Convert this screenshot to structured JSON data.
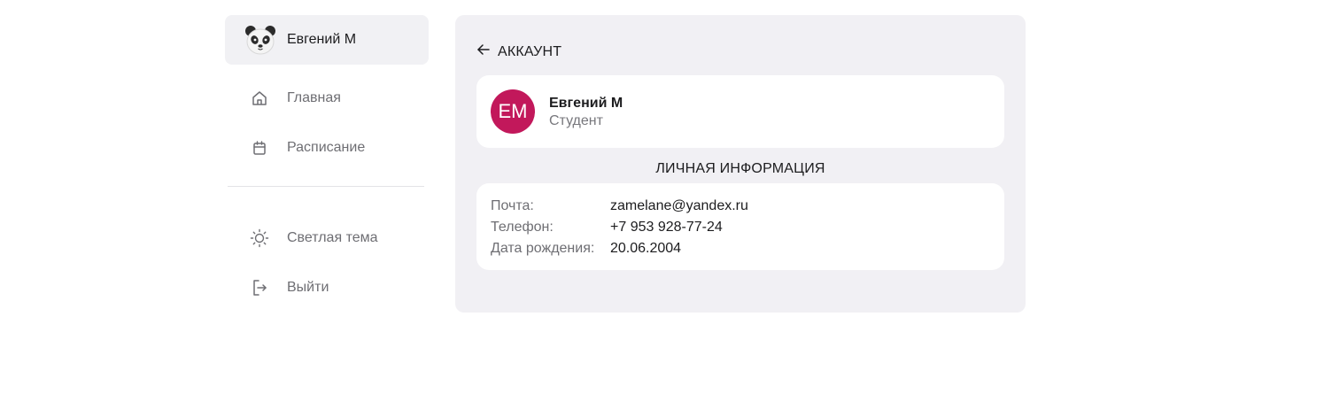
{
  "sidebar": {
    "profile": {
      "name": "Евгений М",
      "avatar_icon": "panda-icon"
    },
    "items": [
      {
        "label": "Главная",
        "icon": "home-icon"
      },
      {
        "label": "Расписание",
        "icon": "calendar-icon"
      }
    ],
    "bottom_items": [
      {
        "label": "Светлая тема",
        "icon": "sun-icon"
      },
      {
        "label": "Выйти",
        "icon": "logout-icon"
      }
    ]
  },
  "account": {
    "back_label": "АККАУНТ",
    "user": {
      "initials": "ЕМ",
      "name": "Евгений М",
      "role": "Студент",
      "avatar_color": "#c2185b"
    },
    "section_title": "ЛИЧНАЯ ИНФОРМАЦИЯ",
    "info": [
      {
        "label": "Почта:",
        "value": "zamelane@yandex.ru"
      },
      {
        "label": "Телефон:",
        "value": "+7 953 928-77-24"
      },
      {
        "label": "Дата рождения:",
        "value": "20.06.2004"
      }
    ]
  }
}
